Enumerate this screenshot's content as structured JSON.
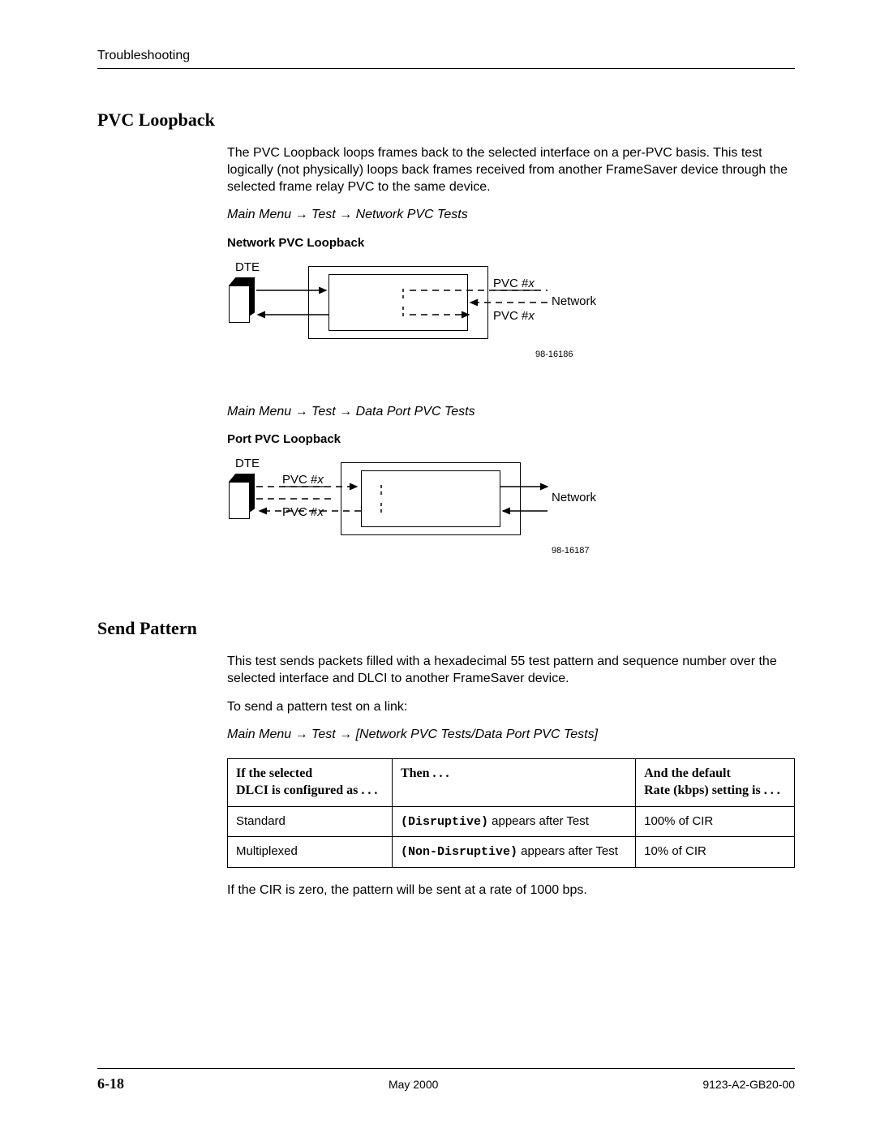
{
  "header": {
    "section": "Troubleshooting"
  },
  "pvc": {
    "heading": "PVC Loopback",
    "intro": "The PVC Loopback loops frames back to the selected interface on a per-PVC basis. This test logically (not physically) loops back frames received from another FrameSaver device through the selected frame relay PVC to the same device.",
    "nav1": "Main Menu → Test → Network PVC Tests",
    "sub1": "Network PVC Loopback",
    "diag1": {
      "dte": "DTE",
      "network": "Network",
      "pvc_top": "PVC #",
      "pvc_top_x": "x",
      "pvc_bot": "PVC #",
      "pvc_bot_x": "x",
      "num": "98-16186"
    },
    "nav2": "Main Menu → Test → Data Port PVC Tests",
    "sub2": "Port PVC Loopback",
    "diag2": {
      "dte": "DTE",
      "network": "Network",
      "pvc_top": "PVC #",
      "pvc_top_x": "x",
      "pvc_bot": "PVC #",
      "pvc_bot_x": "x",
      "num": "98-16187"
    }
  },
  "send": {
    "heading": "Send Pattern",
    "intro": "This test sends packets filled with a hexadecimal 55 test pattern and sequence number over the selected interface and DLCI to another FrameSaver device.",
    "lead": "To send a pattern test on a link:",
    "nav": "Main Menu → Test → [Network PVC Tests/Data Port PVC Tests]",
    "table": {
      "h1a": "If the selected",
      "h1b": "DLCI is configured as . . .",
      "h2": "Then . . .",
      "h3a": "And the default",
      "h3b": "Rate (kbps) setting is . . .",
      "r1c1": "Standard",
      "r1c2a": "(Disruptive)",
      "r1c2b": " appears after Test",
      "r1c3": "100% of CIR",
      "r2c1": "Multiplexed",
      "r2c2a": "(Non-Disruptive)",
      "r2c2b": " appears after Test",
      "r2c3": "10% of CIR"
    },
    "note": "If the CIR is zero, the pattern will be sent at a rate of 1000 bps."
  },
  "footer": {
    "page": "6-18",
    "date": "May 2000",
    "doc": "9123-A2-GB20-00"
  }
}
